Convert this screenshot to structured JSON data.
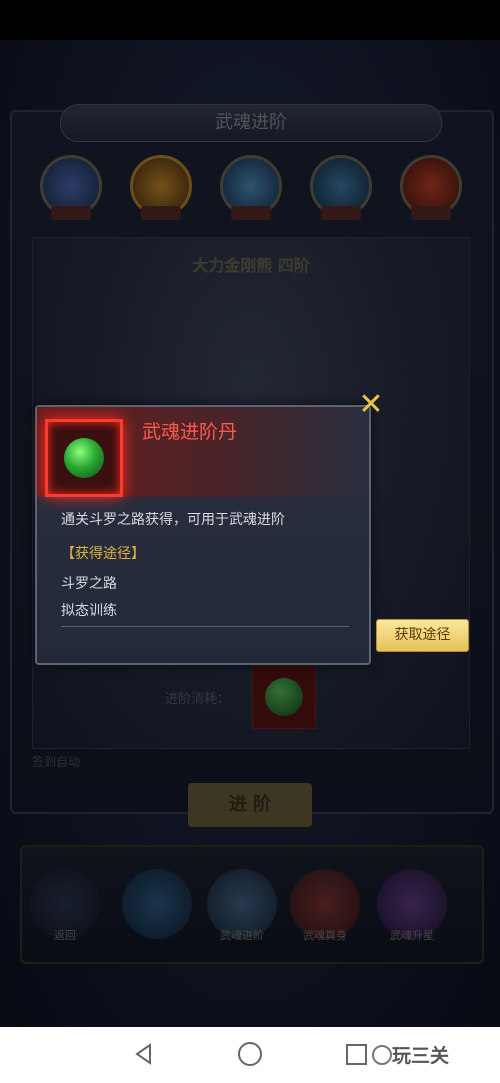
{
  "popup": {
    "item_name": "武魂进阶丹",
    "description": "通关斗罗之路获得，可用于武魂进阶",
    "source_title": "【获得途径】",
    "sources": [
      "斗罗之路",
      "拟态训练"
    ],
    "get_button": "获取途径",
    "close_icon": "close-x-icon"
  },
  "background": {
    "panel_title": "武魂进阶",
    "viewer_title": "大力金刚熊  四阶",
    "need_label": "进阶消耗：",
    "auto_label": "签到自动",
    "advance_button": "进 阶",
    "bottom_buttons": [
      "返回",
      "",
      "武魂进阶",
      "武魂真身",
      "武魂升星"
    ]
  },
  "navbar": {
    "watermark": "玩三关"
  },
  "colors": {
    "accent_red": "#ff3b2f",
    "item_name_red": "#ff5a4e",
    "source_gold": "#e1b33a",
    "button_gold": "#e6c25a"
  }
}
